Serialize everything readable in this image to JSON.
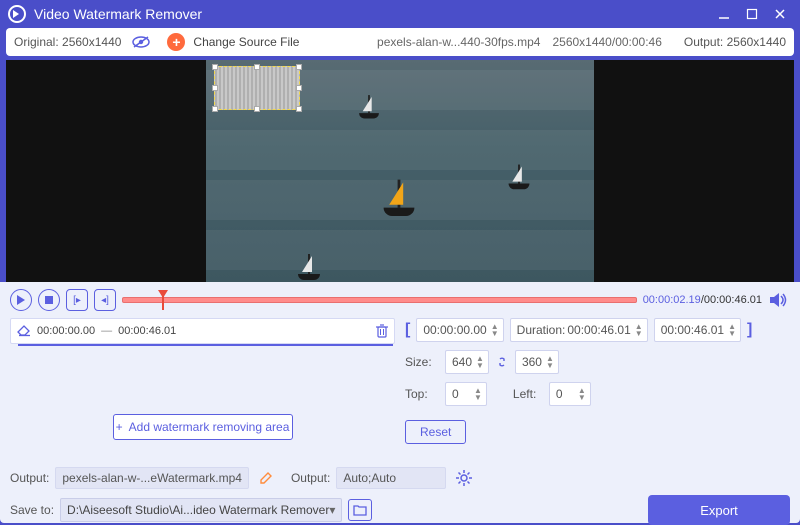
{
  "app": {
    "title": "Video Watermark Remover"
  },
  "topstrip": {
    "original_prefix": "Original:",
    "original_res": "2560x1440",
    "change_source": "Change Source File",
    "filename": "pexels-alan-w...440-30fps.mp4",
    "file_meta": "2560x1440/00:00:46",
    "output_prefix": "Output:",
    "output_res": "2560x1440"
  },
  "timeline": {
    "current": "00:00:02.19",
    "total": "00:00:46.01"
  },
  "segment": {
    "start": "00:00:00.00",
    "sep": "—",
    "end": "00:00:46.01"
  },
  "add_area_label": "Add watermark removing area",
  "clip": {
    "start": "00:00:00.00",
    "dur_label": "Duration:",
    "dur": "00:00:46.01",
    "end": "00:00:46.01"
  },
  "size": {
    "label": "Size:",
    "w": "640",
    "h": "360"
  },
  "pos": {
    "top_label": "Top:",
    "top": "0",
    "left_label": "Left:",
    "left": "0"
  },
  "reset_label": "Reset",
  "bottom": {
    "output_label": "Output:",
    "output_file": "pexels-alan-w-...eWatermark.mp4",
    "output2_label": "Output:",
    "output2_val": "Auto;Auto",
    "save_label": "Save to:",
    "save_path": "D:\\Aiseesoft Studio\\Ai...ideo Watermark Remover",
    "export": "Export"
  }
}
